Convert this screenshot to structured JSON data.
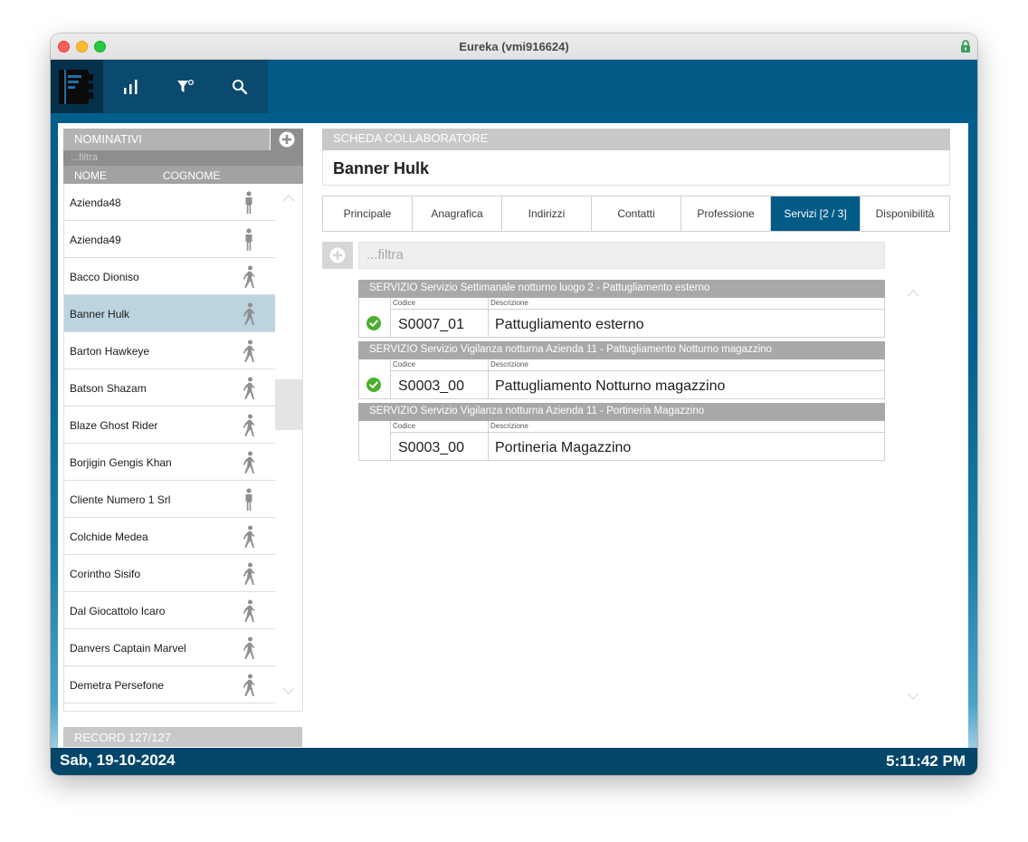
{
  "window": {
    "title": "Eureka (vmi916624)"
  },
  "toolbar": {
    "icons": [
      "notebook-logo-icon",
      "bar-chart-icon",
      "filter-reset-icon",
      "search-icon"
    ]
  },
  "left_panel": {
    "header": "NOMINATIVI",
    "filter_placeholder": "...filtra",
    "col_nome": "NOME",
    "col_cognome": "COGNOME",
    "items": [
      {
        "label": "Azienda48",
        "type": "person-standing"
      },
      {
        "label": "Azienda49",
        "type": "person-standing"
      },
      {
        "label": "Bacco Dioniso",
        "type": "person-walking"
      },
      {
        "label": "Banner Hulk",
        "type": "person-walking",
        "selected": true
      },
      {
        "label": "Barton Hawkeye",
        "type": "person-walking"
      },
      {
        "label": "Batson Shazam",
        "type": "person-walking"
      },
      {
        "label": "Blaze Ghost Rider",
        "type": "person-walking"
      },
      {
        "label": "Borjigin Gengis Khan",
        "type": "person-walking"
      },
      {
        "label": "Cliente Numero 1 Srl",
        "type": "person-standing"
      },
      {
        "label": "Colchide Medea",
        "type": "person-walking"
      },
      {
        "label": "Corintho Sisifo",
        "type": "person-walking"
      },
      {
        "label": "Dal Giocattolo Icaro",
        "type": "person-walking"
      },
      {
        "label": "Danvers Captain Marvel",
        "type": "person-walking"
      },
      {
        "label": "Demetra Persefone",
        "type": "person-walking"
      }
    ],
    "record": "RECORD 127/127"
  },
  "card": {
    "header": "SCHEDA COLLABORATORE",
    "name": "Banner Hulk",
    "tabs": [
      {
        "label": "Principale",
        "active": false
      },
      {
        "label": "Anagrafica",
        "active": false
      },
      {
        "label": "Indirizzi",
        "active": false
      },
      {
        "label": "Contatti",
        "active": false
      },
      {
        "label": "Professione",
        "active": false
      },
      {
        "label": "Servizi [2 / 3]",
        "active": true
      },
      {
        "label": "Disponibilità",
        "active": false
      }
    ],
    "services_filter_placeholder": "...filtra",
    "services": [
      {
        "title": "SERVIZIO Servizio Settimanale notturno luogo 2 - Pattugliamento esterno",
        "code_label": "Codice",
        "desc_label": "Descrizione",
        "code": "S0007_01",
        "description": "Pattugliamento esterno",
        "checked": true
      },
      {
        "title": "SERVIZIO Servizio Vigilanza notturna Azienda 11 - Pattugliamento Notturno magazzino",
        "code_label": "Codice",
        "desc_label": "Descrizione",
        "code": "S0003_00",
        "description": "Pattugliamento Notturno magazzino",
        "checked": true
      },
      {
        "title": "SERVIZIO Servizio Vigilanza notturna Azienda 11 - Portineria Magazzino",
        "code_label": "Codice",
        "desc_label": "Descrizione",
        "code": "S0003_00",
        "description": "Portineria Magazzino",
        "checked": false
      }
    ]
  },
  "status": {
    "date": "Sab, 19-10-2024",
    "time": "5:11:42 PM"
  },
  "colors": {
    "brand": "#025a87",
    "selected_row": "#bcd4e0",
    "check_green": "#4caf2f"
  }
}
